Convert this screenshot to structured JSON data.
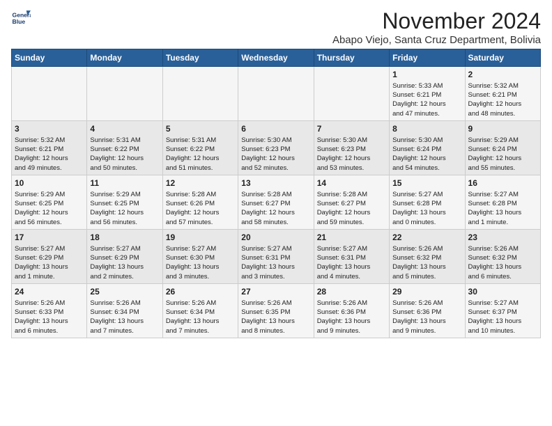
{
  "logo": {
    "line1": "General",
    "line2": "Blue"
  },
  "title": "November 2024",
  "subtitle": "Abapo Viejo, Santa Cruz Department, Bolivia",
  "header": {
    "days": [
      "Sunday",
      "Monday",
      "Tuesday",
      "Wednesday",
      "Thursday",
      "Friday",
      "Saturday"
    ]
  },
  "weeks": [
    [
      {
        "day": "",
        "text": ""
      },
      {
        "day": "",
        "text": ""
      },
      {
        "day": "",
        "text": ""
      },
      {
        "day": "",
        "text": ""
      },
      {
        "day": "",
        "text": ""
      },
      {
        "day": "1",
        "text": "Sunrise: 5:33 AM\nSunset: 6:21 PM\nDaylight: 12 hours\nand 47 minutes."
      },
      {
        "day": "2",
        "text": "Sunrise: 5:32 AM\nSunset: 6:21 PM\nDaylight: 12 hours\nand 48 minutes."
      }
    ],
    [
      {
        "day": "3",
        "text": "Sunrise: 5:32 AM\nSunset: 6:21 PM\nDaylight: 12 hours\nand 49 minutes."
      },
      {
        "day": "4",
        "text": "Sunrise: 5:31 AM\nSunset: 6:22 PM\nDaylight: 12 hours\nand 50 minutes."
      },
      {
        "day": "5",
        "text": "Sunrise: 5:31 AM\nSunset: 6:22 PM\nDaylight: 12 hours\nand 51 minutes."
      },
      {
        "day": "6",
        "text": "Sunrise: 5:30 AM\nSunset: 6:23 PM\nDaylight: 12 hours\nand 52 minutes."
      },
      {
        "day": "7",
        "text": "Sunrise: 5:30 AM\nSunset: 6:23 PM\nDaylight: 12 hours\nand 53 minutes."
      },
      {
        "day": "8",
        "text": "Sunrise: 5:30 AM\nSunset: 6:24 PM\nDaylight: 12 hours\nand 54 minutes."
      },
      {
        "day": "9",
        "text": "Sunrise: 5:29 AM\nSunset: 6:24 PM\nDaylight: 12 hours\nand 55 minutes."
      }
    ],
    [
      {
        "day": "10",
        "text": "Sunrise: 5:29 AM\nSunset: 6:25 PM\nDaylight: 12 hours\nand 56 minutes."
      },
      {
        "day": "11",
        "text": "Sunrise: 5:29 AM\nSunset: 6:25 PM\nDaylight: 12 hours\nand 56 minutes."
      },
      {
        "day": "12",
        "text": "Sunrise: 5:28 AM\nSunset: 6:26 PM\nDaylight: 12 hours\nand 57 minutes."
      },
      {
        "day": "13",
        "text": "Sunrise: 5:28 AM\nSunset: 6:27 PM\nDaylight: 12 hours\nand 58 minutes."
      },
      {
        "day": "14",
        "text": "Sunrise: 5:28 AM\nSunset: 6:27 PM\nDaylight: 12 hours\nand 59 minutes."
      },
      {
        "day": "15",
        "text": "Sunrise: 5:27 AM\nSunset: 6:28 PM\nDaylight: 13 hours\nand 0 minutes."
      },
      {
        "day": "16",
        "text": "Sunrise: 5:27 AM\nSunset: 6:28 PM\nDaylight: 13 hours\nand 1 minute."
      }
    ],
    [
      {
        "day": "17",
        "text": "Sunrise: 5:27 AM\nSunset: 6:29 PM\nDaylight: 13 hours\nand 1 minute."
      },
      {
        "day": "18",
        "text": "Sunrise: 5:27 AM\nSunset: 6:29 PM\nDaylight: 13 hours\nand 2 minutes."
      },
      {
        "day": "19",
        "text": "Sunrise: 5:27 AM\nSunset: 6:30 PM\nDaylight: 13 hours\nand 3 minutes."
      },
      {
        "day": "20",
        "text": "Sunrise: 5:27 AM\nSunset: 6:31 PM\nDaylight: 13 hours\nand 3 minutes."
      },
      {
        "day": "21",
        "text": "Sunrise: 5:27 AM\nSunset: 6:31 PM\nDaylight: 13 hours\nand 4 minutes."
      },
      {
        "day": "22",
        "text": "Sunrise: 5:26 AM\nSunset: 6:32 PM\nDaylight: 13 hours\nand 5 minutes."
      },
      {
        "day": "23",
        "text": "Sunrise: 5:26 AM\nSunset: 6:32 PM\nDaylight: 13 hours\nand 6 minutes."
      }
    ],
    [
      {
        "day": "24",
        "text": "Sunrise: 5:26 AM\nSunset: 6:33 PM\nDaylight: 13 hours\nand 6 minutes."
      },
      {
        "day": "25",
        "text": "Sunrise: 5:26 AM\nSunset: 6:34 PM\nDaylight: 13 hours\nand 7 minutes."
      },
      {
        "day": "26",
        "text": "Sunrise: 5:26 AM\nSunset: 6:34 PM\nDaylight: 13 hours\nand 7 minutes."
      },
      {
        "day": "27",
        "text": "Sunrise: 5:26 AM\nSunset: 6:35 PM\nDaylight: 13 hours\nand 8 minutes."
      },
      {
        "day": "28",
        "text": "Sunrise: 5:26 AM\nSunset: 6:36 PM\nDaylight: 13 hours\nand 9 minutes."
      },
      {
        "day": "29",
        "text": "Sunrise: 5:26 AM\nSunset: 6:36 PM\nDaylight: 13 hours\nand 9 minutes."
      },
      {
        "day": "30",
        "text": "Sunrise: 5:27 AM\nSunset: 6:37 PM\nDaylight: 13 hours\nand 10 minutes."
      }
    ]
  ]
}
